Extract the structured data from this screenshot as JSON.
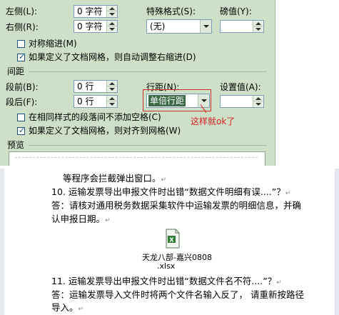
{
  "dialog": {
    "left_label": "左侧(L):",
    "left_value": "0 字符",
    "right_label": "右侧(R):",
    "right_value": "0 字符",
    "special_label": "特殊格式(S):",
    "special_value": "(无)",
    "measure_label": "磅值(Y):",
    "mirror_indent": "对称缩进(M)",
    "auto_right_indent": "如果定义了文档网格，则自动调整右缩进(D)",
    "spacing_section": "间距",
    "before_label": "段前(B):",
    "before_value": "0 行",
    "after_label": "段后(F):",
    "after_value": "0 行",
    "line_spacing_label": "行距(N):",
    "line_spacing_value": "单倍行距",
    "setting_label": "设置值(A):",
    "no_space_same_style": "在相同样式的段落间不添加空格(C)",
    "snap_to_grid": "如果定义了文档网格，则对齐到网格(W)",
    "preview_section": "预览",
    "annotation": "这样就ok了"
  },
  "document": {
    "line1": "等程序会拦截弹出窗口。",
    "item10_q": "10. 运输发票导出申报文件时出错“数据文件明细有误....”？",
    "item10_a1": "答：请核对通用税务数据采集软件中运输发票的明细信息，并确",
    "item10_a2": "认申报日期。",
    "file_name1": "天龙八部-嘉兴0808",
    "file_name2": ".xlsx",
    "item11_q": "11. 运输发票导出申报文件时出错“数据文件名不符....”？",
    "item11_a1": "答：运输发票导入文件时将两个文件名输入反了，  请重新按路径",
    "item11_a2": "导入。"
  },
  "colors": {
    "dialog_bg": "#cfe0c8",
    "highlight": "#c8302a",
    "annotation": "#d42020",
    "selected_bg": "#3d6b4a"
  },
  "icons": [
    "excel-file-icon",
    "checkbox-checked-icon",
    "checkbox-empty-icon",
    "dropdown-arrow-icon",
    "spin-arrows-icon"
  ]
}
